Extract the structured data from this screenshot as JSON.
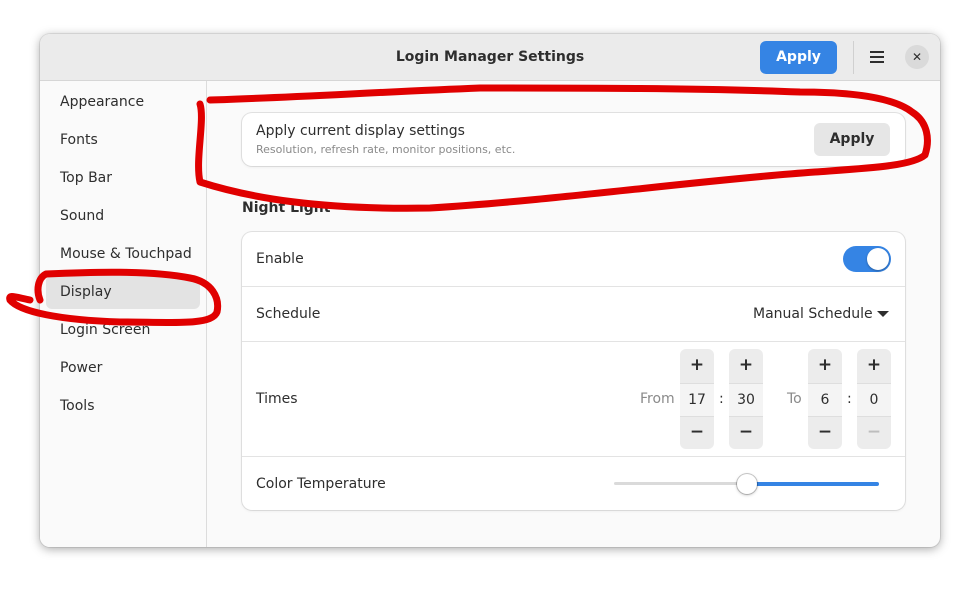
{
  "window": {
    "title": "Login Manager Settings",
    "apply_label": "Apply",
    "menu_icon": "hamburger-menu-icon",
    "close_icon": "close-icon",
    "close_glyph": "✕"
  },
  "sidebar": {
    "items": [
      {
        "label": "Appearance"
      },
      {
        "label": "Fonts"
      },
      {
        "label": "Top Bar"
      },
      {
        "label": "Sound"
      },
      {
        "label": "Mouse & Touchpad"
      },
      {
        "label": "Display",
        "selected": true
      },
      {
        "label": "Login Screen"
      },
      {
        "label": "Power"
      },
      {
        "label": "Tools"
      }
    ]
  },
  "display_settings": {
    "title": "Apply current display settings",
    "subtitle": "Resolution, refresh rate, monitor positions, etc.",
    "apply_label": "Apply"
  },
  "night_light": {
    "heading": "Night Light",
    "enable_label": "Enable",
    "enabled": true,
    "schedule_label": "Schedule",
    "schedule_value": "Manual Schedule",
    "times_label": "Times",
    "from_label": "From",
    "to_label": "To",
    "from_hour": "17",
    "from_minute": "30",
    "to_hour": "6",
    "to_minute": "0",
    "separator": ":",
    "plus": "+",
    "minus": "−",
    "color_temp_label": "Color Temperature",
    "color_temp_fraction": 0.5
  },
  "colors": {
    "accent": "#3584e4",
    "annotation": "#e00000"
  }
}
